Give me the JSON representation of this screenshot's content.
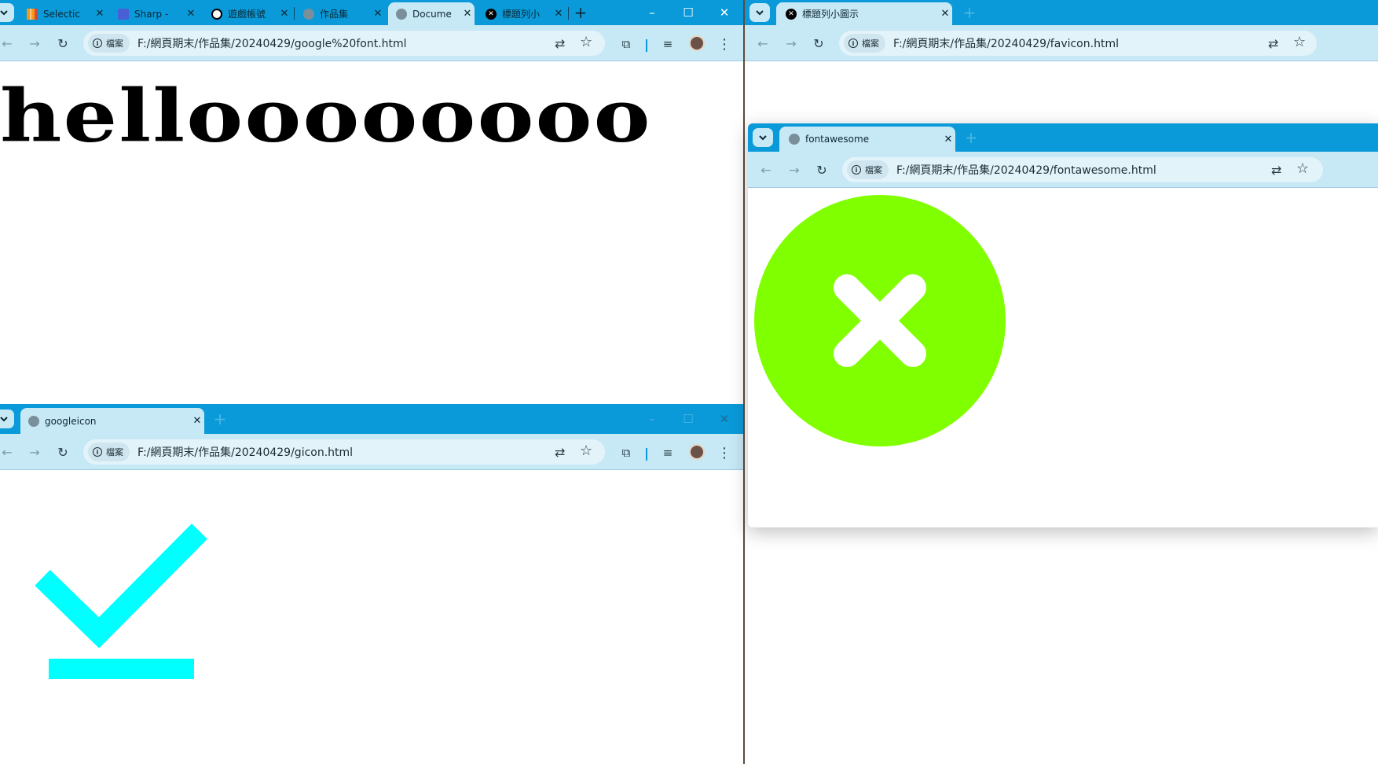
{
  "win1": {
    "tabs": [
      {
        "title": "Selectic",
        "icon": "stripes-icon",
        "color": "#f39a1b"
      },
      {
        "title": "Sharp -",
        "icon": "square-icon",
        "color": "#4a5ed6"
      },
      {
        "title": "遊戲帳號",
        "icon": "openai-icon",
        "color": "#000000"
      },
      {
        "title": "作品集",
        "icon": "globe-icon",
        "color": "#7a8f99"
      },
      {
        "title": "Docume",
        "icon": "globe-icon",
        "color": "#7a8f99"
      },
      {
        "title": "標題列小",
        "icon": "x-circle-icon",
        "color": "#000000"
      }
    ],
    "chip": "檔案",
    "url": "F:/網頁期末/作品集/20240429/google%20font.html",
    "content_text": "helloooooooo"
  },
  "win2": {
    "tab_title": "googleicon",
    "chip": "檔案",
    "url": "F:/網頁期末/作品集/20240429/gicon.html",
    "icon_color": "#00ffff"
  },
  "win3": {
    "tab_title": "標題列小圖示",
    "chip": "檔案",
    "url": "F:/網頁期末/作品集/20240429/favicon.html"
  },
  "win4": {
    "tab_title": "fontawesome",
    "chip": "檔案",
    "url": "F:/網頁期末/作品集/20240429/fontawesome.html",
    "icon_color": "#80ff00"
  },
  "symbols": {
    "close": "✕",
    "plus": "+",
    "back": "←",
    "forward": "→",
    "reload": "↻",
    "star": "☆",
    "minimize": "–",
    "maximize": "☐",
    "kebab": "⋮",
    "info": "i",
    "chev": "⌄",
    "translate": "⇄",
    "puzzle": "⧉",
    "media": "≡"
  }
}
